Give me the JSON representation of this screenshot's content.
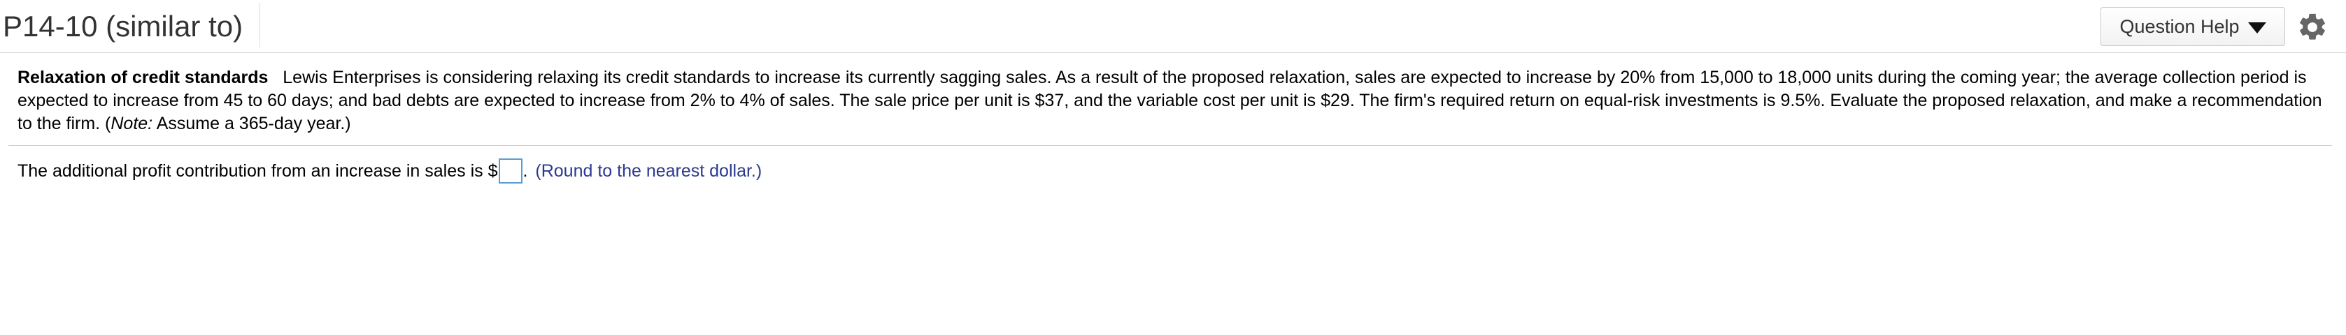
{
  "header": {
    "title": "P14-10 (similar to)",
    "help_button_label": "Question Help",
    "settings_icon": "gear-icon"
  },
  "problem": {
    "heading": "Relaxation of credit standards",
    "text_before_note": "Lewis Enterprises is considering relaxing its credit standards to increase its currently sagging sales.  As a result of the proposed relaxation, sales are expected to increase by 20% from 15,000 to 18,000 units during the coming year; the average collection period is expected to increase from 45 to 60 days; and bad debts are expected to increase from 2% to 4% of sales.  The sale price per unit is $37, and the variable cost per unit is $29.  The firm's required return on equal-risk investments is 9.5%.  Evaluate the proposed relaxation, and make a recommendation to the firm.  (",
    "note_label": "Note:",
    "note_text": " Assume a 365-day year.)"
  },
  "question": {
    "prompt": "The additional profit contribution from an increase in sales is $",
    "answer_value": "",
    "after_box": ".",
    "hint": "(Round to the nearest dollar.)"
  },
  "colors": {
    "hint_text": "#2b3a8f",
    "input_border": "#5b9bd5"
  }
}
